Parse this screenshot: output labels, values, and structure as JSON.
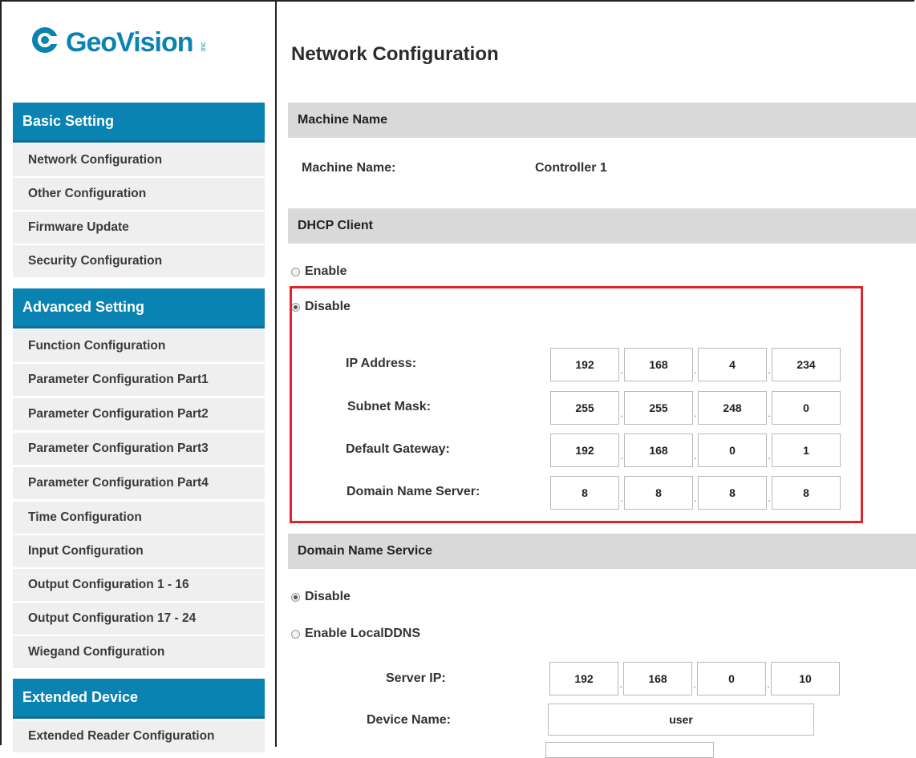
{
  "brand": {
    "logo_text": "GeoVision",
    "logo_suffix": "inc"
  },
  "sidebar": {
    "basic": {
      "title": "Basic Setting",
      "items": [
        "Network Configuration",
        "Other Configuration",
        "Firmware Update",
        "Security Configuration"
      ]
    },
    "advanced": {
      "title": "Advanced Setting",
      "items": [
        "Function Configuration",
        "Parameter Configuration Part1",
        "Parameter Configuration Part2",
        "Parameter Configuration Part3",
        "Parameter Configuration Part4",
        "Time Configuration",
        "Input Configuration",
        "Output Configuration 1 - 16",
        "Output Configuration 17 - 24",
        "Wiegand Configuration"
      ]
    },
    "extended": {
      "title": "Extended Device",
      "items": [
        "Extended Reader Configuration"
      ]
    }
  },
  "main": {
    "title": "Network Configuration",
    "machine": {
      "section": "Machine Name",
      "label": "Machine Name:",
      "value": "Controller 1"
    },
    "dhcp": {
      "section": "DHCP Client",
      "enable_label": "Enable",
      "disable_label": "Disable",
      "selected": "Disable",
      "ip_label": "IP Address:",
      "ip": [
        "192",
        "168",
        "4",
        "234"
      ],
      "mask_label": "Subnet Mask:",
      "mask": [
        "255",
        "255",
        "248",
        "0"
      ],
      "gateway_label": "Default Gateway:",
      "gateway": [
        "192",
        "168",
        "0",
        "1"
      ],
      "dns_label": "Domain Name Server:",
      "dns": [
        "8",
        "8",
        "8",
        "8"
      ]
    },
    "dns_service": {
      "section": "Domain Name Service",
      "disable_label": "Disable",
      "enable_label": "Enable LocalDDNS",
      "selected": "Disable",
      "server_ip_label": "Server IP:",
      "server_ip": [
        "192",
        "168",
        "0",
        "10"
      ],
      "device_name_label": "Device Name:",
      "device_name": "user"
    }
  },
  "colors": {
    "accent": "#0b83b2",
    "highlight_border": "#e0242b",
    "band": "#d9d9d9"
  }
}
